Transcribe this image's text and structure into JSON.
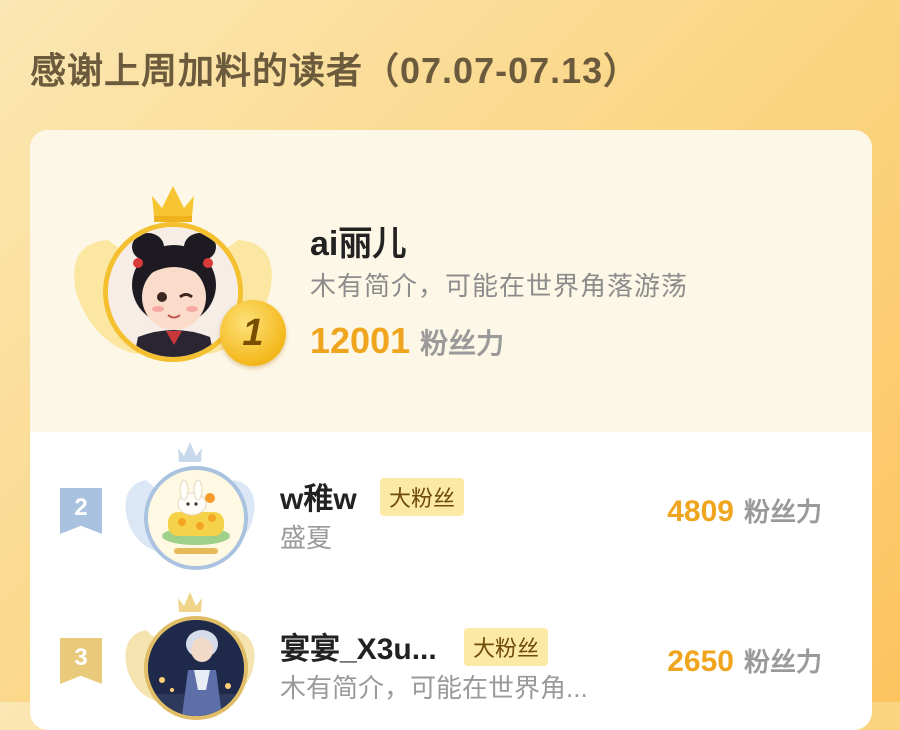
{
  "header": {
    "title": "感谢上周加料的读者（07.07-07.13）"
  },
  "top_reader": {
    "rank": "1",
    "name": "ai丽儿",
    "bio": "木有简介，可能在世界角落游荡",
    "score": "12001",
    "score_unit": "粉丝力"
  },
  "readers": [
    {
      "rank": "2",
      "name": "w稚w",
      "tag": "大粉丝",
      "bio": "盛夏",
      "score": "4809",
      "score_unit": "粉丝力"
    },
    {
      "rank": "3",
      "name": "宴宴_X3u...",
      "tag": "大粉丝",
      "bio": "木有简介，可能在世界角...",
      "score": "2650",
      "score_unit": "粉丝力"
    }
  ],
  "colors": {
    "gold": "#f4b81c",
    "silver": "#a9c2e0",
    "bronze": "#e9c97a",
    "score": "#f0a51e"
  }
}
